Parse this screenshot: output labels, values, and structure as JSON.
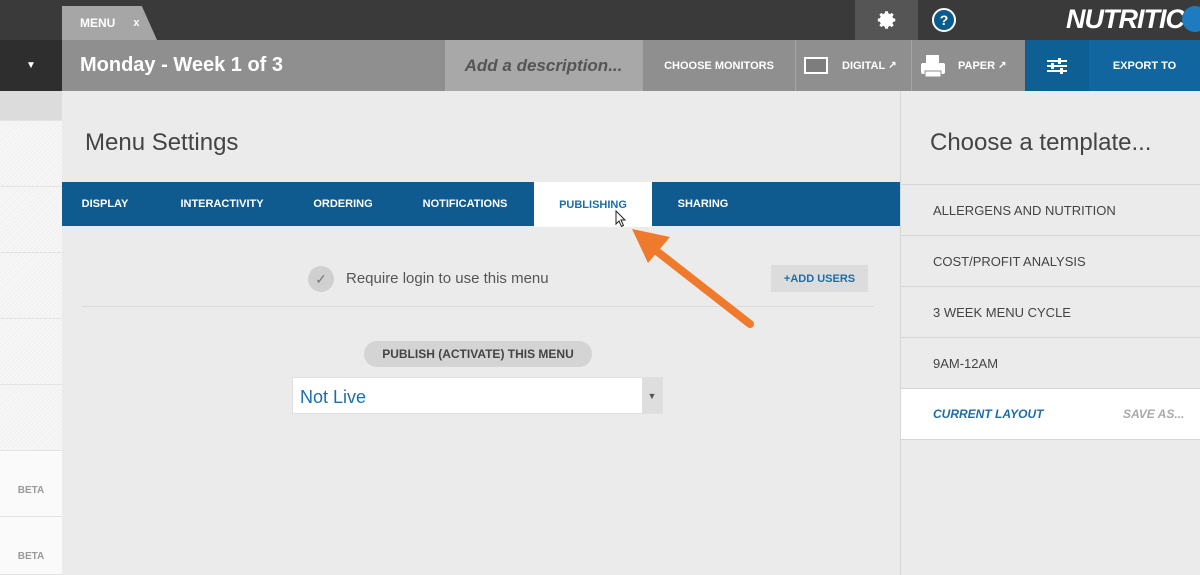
{
  "topbar": {
    "tab_label": "MENU",
    "tab_close": "x",
    "help_label": "?",
    "brand": "NUTRITICS"
  },
  "header": {
    "dropdown_glyph": "▼",
    "title": "Monday - Week 1 of 3",
    "description_placeholder": "Add a description...",
    "choose_monitors": "CHOOSE MONITORS",
    "digital": "DIGITAL",
    "paper": "PAPER",
    "external_arrow": "↗",
    "export": "EXPORT TO"
  },
  "sidebar": {
    "beta_labels": [
      "BETA",
      "BETA"
    ]
  },
  "main": {
    "title": "Menu Settings",
    "tabs": [
      {
        "label": "DISPLAY"
      },
      {
        "label": "INTERACTIVITY"
      },
      {
        "label": "ORDERING"
      },
      {
        "label": "NOTIFICATIONS"
      },
      {
        "label": "PUBLISHING",
        "active": true
      },
      {
        "label": "SHARING"
      }
    ],
    "check_glyph": "✓",
    "require_login_label": "Require login to use this menu",
    "add_users_label": "+ADD USERS",
    "publish_label": "PUBLISH (ACTIVATE) THIS MENU",
    "publish_status": "Not Live",
    "select_arrow": "▼"
  },
  "templates": {
    "title": "Choose a template...",
    "items": [
      {
        "label": "ALLERGENS AND NUTRITION"
      },
      {
        "label": "COST/PROFIT ANALYSIS"
      },
      {
        "label": "3 WEEK MENU CYCLE"
      },
      {
        "label": "9AM-12AM"
      }
    ],
    "current_layout": "CURRENT LAYOUT",
    "save_as": "SAVE AS..."
  },
  "colors": {
    "accent": "#0f5b90",
    "link": "#1d6ea8",
    "annotation_arrow": "#f07a2c"
  },
  "icons": [
    "gear-icon",
    "help-icon",
    "monitor-icon",
    "printer-icon",
    "sliders-icon",
    "check-icon",
    "dropdown-arrow-icon",
    "cursor-icon"
  ]
}
